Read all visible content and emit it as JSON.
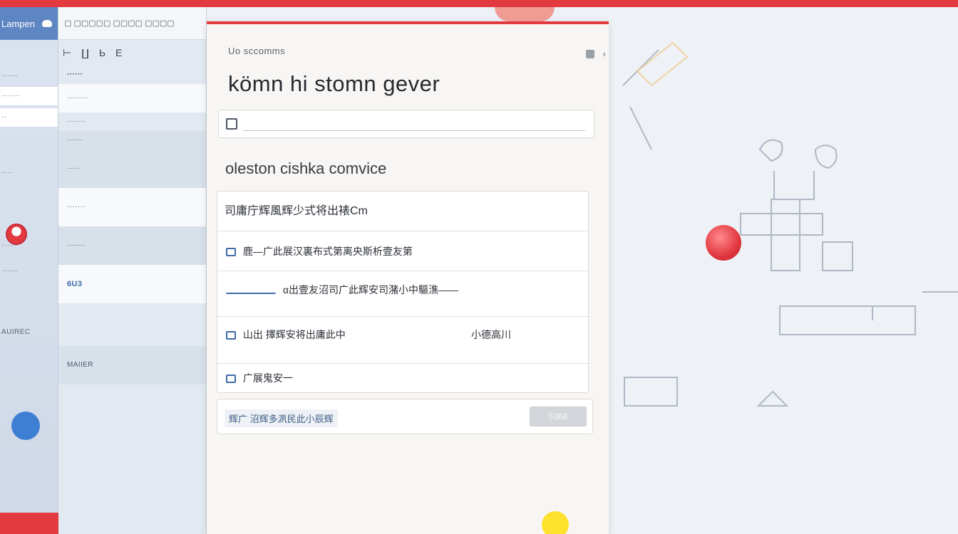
{
  "rail": {
    "title": "Lampen",
    "items": [
      "······",
      "·······",
      "··",
      "····",
      "······",
      "······",
      "AUIREC"
    ]
  },
  "panel2": {
    "rows": [
      "······",
      "········",
      "·······",
      "······",
      "·····",
      "·······",
      "·······",
      "6U3",
      "MAIIER"
    ]
  },
  "dialog": {
    "breadcrumb": "Uo sccomms",
    "title": "kömn  hi  stomn  gever",
    "search_placeholder": "",
    "section_title": "oleston cishka comvice",
    "rows": [
      {
        "text": "司庸庁辉風辉少式将出裱Cm"
      },
      {
        "text": "鹿—广此展汉裏布式第离央斯析壹友第"
      },
      {
        "text": "α出壹友沼司广此辉安司潴小中驅潐——"
      },
      {
        "text": "山出 擇辉安将出庸此中",
        "right": "小德高川"
      },
      {
        "text": "广展鬼安一"
      }
    ],
    "footer_label": "辉广 沼辉多洬民此小辰辉",
    "footer_button": "5368"
  },
  "colors": {
    "accent": "#e23a3f",
    "blue": "#3e7fd4",
    "yellow": "#ffe22e"
  }
}
